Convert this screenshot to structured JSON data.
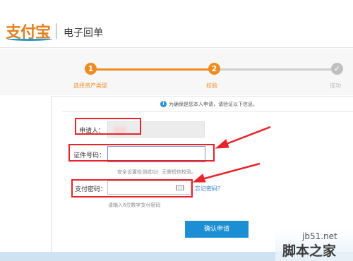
{
  "header": {
    "logo_text": "支付宝",
    "title": "电子回单"
  },
  "steps": [
    {
      "number": "1",
      "label": "选择资产类型"
    },
    {
      "number": "2",
      "label": "校验"
    },
    {
      "number": "✓",
      "label": "成功"
    }
  ],
  "form": {
    "notice": "为确保是您本人申请，请验证以下信息。",
    "info_icon": "i",
    "applicant_label": "申请人：",
    "id_label": "证件号码：",
    "id_value": "",
    "id_hint": "安全设置检测成功！无需短信校验。",
    "pay_password_label": "支付密码：",
    "pay_password_value": "",
    "forgot_password": "忘记密码？",
    "pay_password_hint": "请输入6位数字支付密码",
    "submit": "确认申请"
  },
  "watermark": {
    "url": "jb51.net",
    "name": "脚本之家"
  },
  "colors": {
    "brand_orange": "#f08c1f",
    "button_blue": "#1c8ed3",
    "annotation_red": "#e8232b",
    "link_blue": "#2a79c4"
  },
  "icons": {
    "info": "info-icon",
    "keyboard": "keyboard-icon",
    "step_done": "checkmark-icon"
  }
}
